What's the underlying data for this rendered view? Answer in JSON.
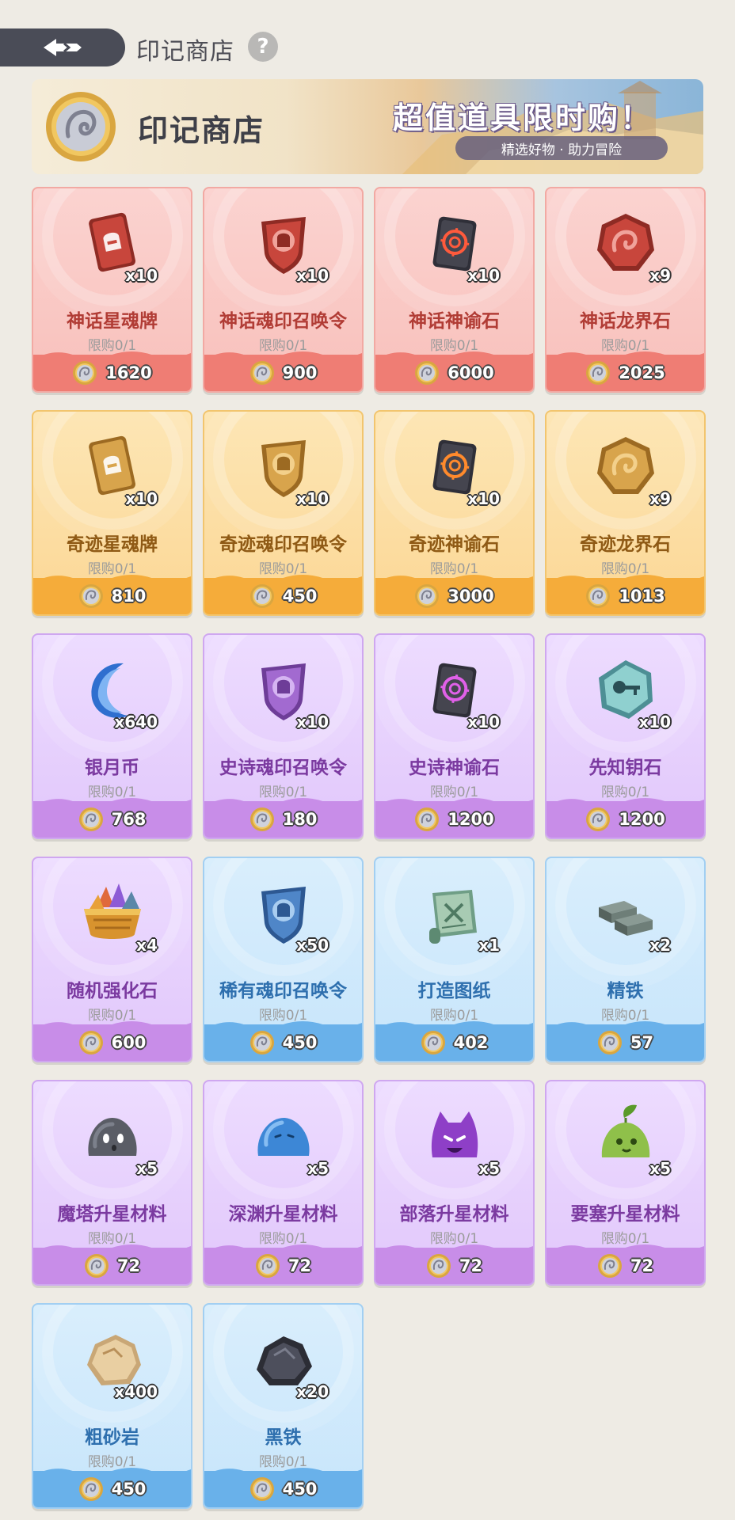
{
  "header": {
    "title": "印记商店"
  },
  "banner": {
    "name": "印记商店",
    "slogan": "超值道具限时购！",
    "subtitle": "精选好物 · 助力冒险"
  },
  "items": [
    {
      "name": "神话星魂牌",
      "qty": "x10",
      "limit": "限购0/1",
      "price": "1620",
      "theme": "red",
      "icon": "card-icon"
    },
    {
      "name": "神话魂印召唤令",
      "qty": "x10",
      "limit": "限购0/1",
      "price": "900",
      "theme": "red",
      "icon": "shield-icon"
    },
    {
      "name": "神话神谕石",
      "qty": "x10",
      "limit": "限购0/1",
      "price": "6000",
      "theme": "red",
      "icon": "oracle-stone-icon"
    },
    {
      "name": "神话龙界石",
      "qty": "x9",
      "limit": "限购0/1",
      "price": "2025",
      "theme": "red",
      "icon": "dragon-stone-icon"
    },
    {
      "name": "奇迹星魂牌",
      "qty": "x10",
      "limit": "限购0/1",
      "price": "810",
      "theme": "gold",
      "icon": "card-icon"
    },
    {
      "name": "奇迹魂印召唤令",
      "qty": "x10",
      "limit": "限购0/1",
      "price": "450",
      "theme": "gold",
      "icon": "shield-icon"
    },
    {
      "name": "奇迹神谕石",
      "qty": "x10",
      "limit": "限购0/1",
      "price": "3000",
      "theme": "gold",
      "icon": "oracle-stone-icon"
    },
    {
      "name": "奇迹龙界石",
      "qty": "x9",
      "limit": "限购0/1",
      "price": "1013",
      "theme": "gold",
      "icon": "dragon-stone-icon"
    },
    {
      "name": "银月币",
      "qty": "x640",
      "limit": "限购0/1",
      "price": "768",
      "theme": "purple",
      "icon": "moon-coin-icon"
    },
    {
      "name": "史诗魂印召唤令",
      "qty": "x10",
      "limit": "限购0/1",
      "price": "180",
      "theme": "purple",
      "icon": "shield-icon"
    },
    {
      "name": "史诗神谕石",
      "qty": "x10",
      "limit": "限购0/1",
      "price": "1200",
      "theme": "purple",
      "icon": "oracle-stone-icon"
    },
    {
      "name": "先知钥石",
      "qty": "x10",
      "limit": "限购0/1",
      "price": "1200",
      "theme": "purple",
      "icon": "key-stone-icon"
    },
    {
      "name": "随机强化石",
      "qty": "x4",
      "limit": "限购0/1",
      "price": "600",
      "theme": "purple",
      "icon": "gem-basket-icon"
    },
    {
      "name": "稀有魂印召唤令",
      "qty": "x50",
      "limit": "限购0/1",
      "price": "450",
      "theme": "blue",
      "icon": "shield-icon"
    },
    {
      "name": "打造图纸",
      "qty": "x1",
      "limit": "限购0/1",
      "price": "402",
      "theme": "blue",
      "icon": "blueprint-scroll-icon"
    },
    {
      "name": "精铁",
      "qty": "x2",
      "limit": "限购0/1",
      "price": "57",
      "theme": "blue",
      "icon": "iron-ingot-icon"
    },
    {
      "name": "魔塔升星材料",
      "qty": "x5",
      "limit": "限购0/1",
      "price": "72",
      "theme": "purple",
      "icon": "gray-slime-icon"
    },
    {
      "name": "深渊升星材料",
      "qty": "x5",
      "limit": "限购0/1",
      "price": "72",
      "theme": "purple",
      "icon": "blue-slime-icon"
    },
    {
      "name": "部落升星材料",
      "qty": "x5",
      "limit": "限购0/1",
      "price": "72",
      "theme": "purple",
      "icon": "purple-slime-icon"
    },
    {
      "name": "要塞升星材料",
      "qty": "x5",
      "limit": "限购0/1",
      "price": "72",
      "theme": "purple",
      "icon": "green-slime-icon"
    },
    {
      "name": "粗砂岩",
      "qty": "x400",
      "limit": "限购0/1",
      "price": "450",
      "theme": "blue",
      "icon": "sandstone-icon"
    },
    {
      "name": "黑铁",
      "qty": "x20",
      "limit": "限购0/1",
      "price": "450",
      "theme": "blue",
      "icon": "black-iron-icon"
    }
  ]
}
